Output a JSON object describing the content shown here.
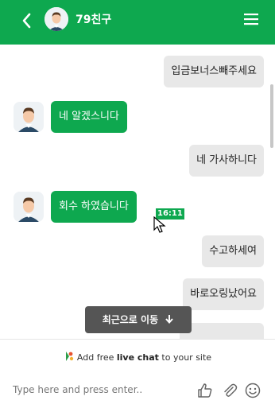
{
  "header": {
    "name": "79친구"
  },
  "messages": [
    {
      "from": "agent",
      "text": "입금보너스빼주세요"
    },
    {
      "from": "user",
      "text": "네 알겠스니다"
    },
    {
      "from": "agent",
      "text": "네 가사하니다"
    },
    {
      "from": "user",
      "text": "회수 하였습니다",
      "time": "16:11"
    },
    {
      "from": "agent",
      "text": "수고하세여"
    },
    {
      "from": "agent",
      "text": "바로오링났어요"
    }
  ],
  "jump_button": "최근으로 이동",
  "promo": {
    "pre": "Add free ",
    "bold": "live chat",
    "post": " to your site"
  },
  "composer": {
    "placeholder": "Type here and press enter.."
  },
  "colors": {
    "accent": "#0ea84f",
    "bubble_out": "#e8e8e8"
  }
}
